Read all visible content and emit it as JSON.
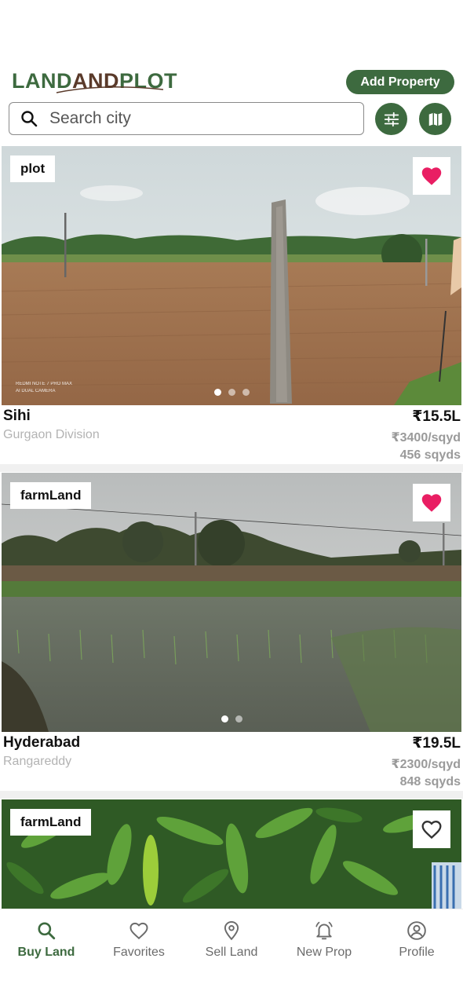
{
  "header": {
    "logo": {
      "part1": "LAND",
      "part2": "AND",
      "part3": "PLOT"
    },
    "add_property_label": "Add Property",
    "search_placeholder": "Search city",
    "filter_icon": "sliders-icon",
    "map_icon": "map-icon"
  },
  "colors": {
    "brand_green": "#3d6a3f",
    "heart_pink": "#e91e63",
    "muted_text": "#b3b3b3"
  },
  "listings": [
    {
      "tag": "plot",
      "favorited": true,
      "city": "Sihi",
      "district": "Gurgaon Division",
      "price": "₹15.5L",
      "rate": "₹3400/sqyd",
      "area": "456 sqyds",
      "image_count": 3,
      "active_image": 1,
      "watermark": "REDMI NOTE 7 PRO MAX\nAI DUAL CAMERA"
    },
    {
      "tag": "farmLand",
      "favorited": true,
      "city": "Hyderabad",
      "district": "Rangareddy",
      "price": "₹19.5L",
      "rate": "₹2300/sqyd",
      "area": "848 sqyds",
      "image_count": 2,
      "active_image": 1
    },
    {
      "tag": "farmLand",
      "favorited": false
    }
  ],
  "nav": [
    {
      "label": "Buy Land",
      "icon": "search-icon",
      "active": true
    },
    {
      "label": "Favorites",
      "icon": "heart-outline-icon",
      "active": false
    },
    {
      "label": "Sell Land",
      "icon": "location-pin-icon",
      "active": false
    },
    {
      "label": "New Prop",
      "icon": "bell-icon",
      "active": false
    },
    {
      "label": "Profile",
      "icon": "profile-icon",
      "active": false
    }
  ]
}
